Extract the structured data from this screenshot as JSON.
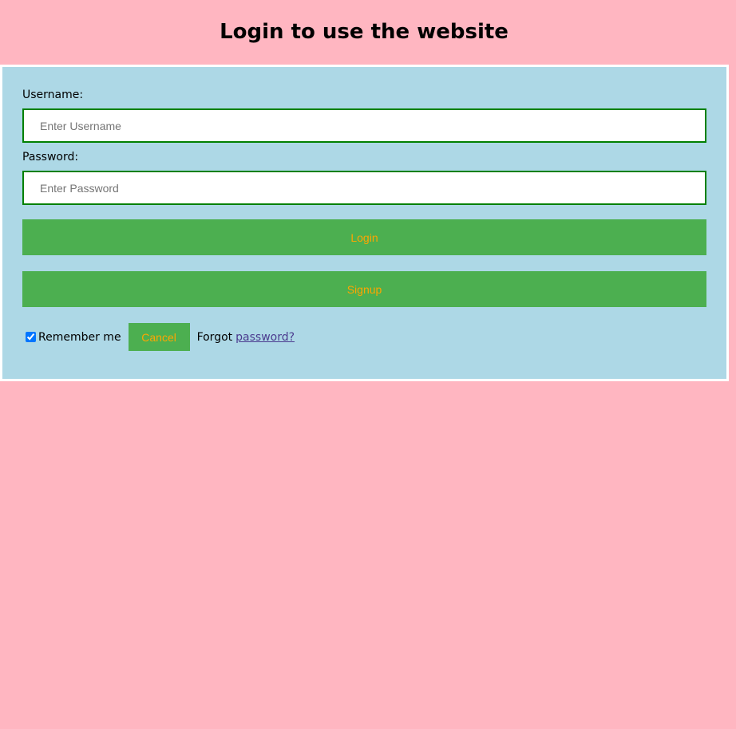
{
  "page": {
    "title": "Login to use the website"
  },
  "form": {
    "username_label": "Username:",
    "username_placeholder": "Enter Username",
    "username_value": "",
    "password_label": "Password:",
    "password_placeholder": "Enter Password",
    "password_value": "",
    "login_label": "Login",
    "signup_label": "Signup",
    "remember_label": "Remember me",
    "remember_checked": true,
    "cancel_label": "Cancel",
    "forgot_text": "Forgot",
    "forgot_link_text": "password?"
  },
  "colors": {
    "page_background": "#ffb6c1",
    "card_background": "#add8e6",
    "button_background": "#4caf50",
    "button_text": "#ffa500",
    "input_border": "#008000"
  }
}
